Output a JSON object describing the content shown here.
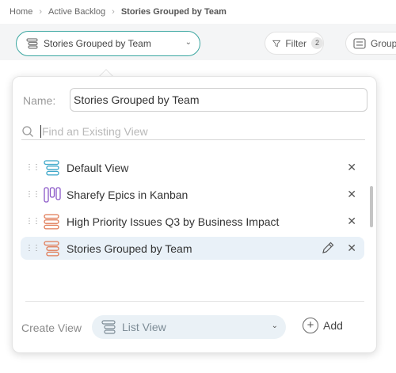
{
  "breadcrumb": [
    "Home",
    "Active Backlog",
    "Stories Grouped by Team"
  ],
  "toolbar": {
    "current_view": "Stories Grouped by Team",
    "filter_label": "Filter",
    "filter_count": "2",
    "group_label": "Group"
  },
  "panel": {
    "name_label": "Name:",
    "name_value": "Stories Grouped by Team",
    "search_placeholder": "Find an Existing View",
    "views": [
      {
        "label": "Default View",
        "icon": "list-icon",
        "color": "#3aa6c8"
      },
      {
        "label": "Sharefy Epics in Kanban",
        "icon": "kanban-icon",
        "color": "#8a57c8"
      },
      {
        "label": "High Priority Issues Q3 by Business Impact",
        "icon": "list-icon",
        "color": "#e07a55"
      },
      {
        "label": "Stories Grouped by Team",
        "icon": "list-icon",
        "color": "#e07a55",
        "active": true
      }
    ],
    "create_label": "Create View",
    "create_type": "List View",
    "add_label": "Add"
  },
  "colors": {
    "accent": "#3aa6a0",
    "active_row": "#e9f1f8"
  }
}
